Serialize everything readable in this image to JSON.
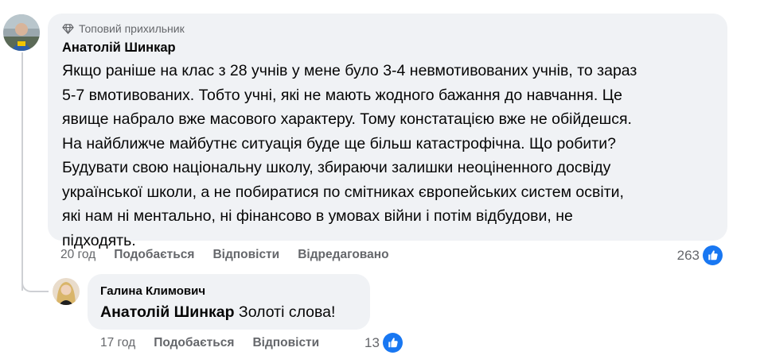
{
  "comment": {
    "badge": "Топовий прихильник",
    "author": "Анатолій Шинкар",
    "lines": [
      "Якщо раніше на клас з 28 учнів у мене було 3-4 невмотивованих учнів, то зараз",
      "5-7 вмотивованих. Тобто учні, які не мають жодного бажання до навчання. Це",
      "явище набрало вже масового характеру. Тому констатацією вже не обійдешся.",
      "На найближче майбутнє ситуація буде ще більш катастрофічна. Що робити?",
      "Будувати свою національну школу, збираючи залишки неоціненного досвіду",
      "української школи, а не побиратися по смітниках європейських систем освіти,",
      "які нам ні ментально, ні фінансово в умовах війни і потім відбудови, не",
      "підходять."
    ],
    "time": "20 год",
    "like_label": "Подобається",
    "reply_label": "Відповісти",
    "edited_label": "Відредаговано",
    "reaction_count": "263"
  },
  "reply": {
    "author": "Галина Климович",
    "mention": "Анатолій Шинкар",
    "text": " Золоті слова!",
    "time": "17 год",
    "like_label": "Подобається",
    "reply_label": "Відповісти",
    "reaction_count": "13"
  },
  "colors": {
    "bubble_bg": "#f0f2f5",
    "secondary_text": "#65676b",
    "like_blue": "#1877f2"
  },
  "icons": {
    "badge": "diamond-icon",
    "reaction": "thumbs-up-icon"
  }
}
